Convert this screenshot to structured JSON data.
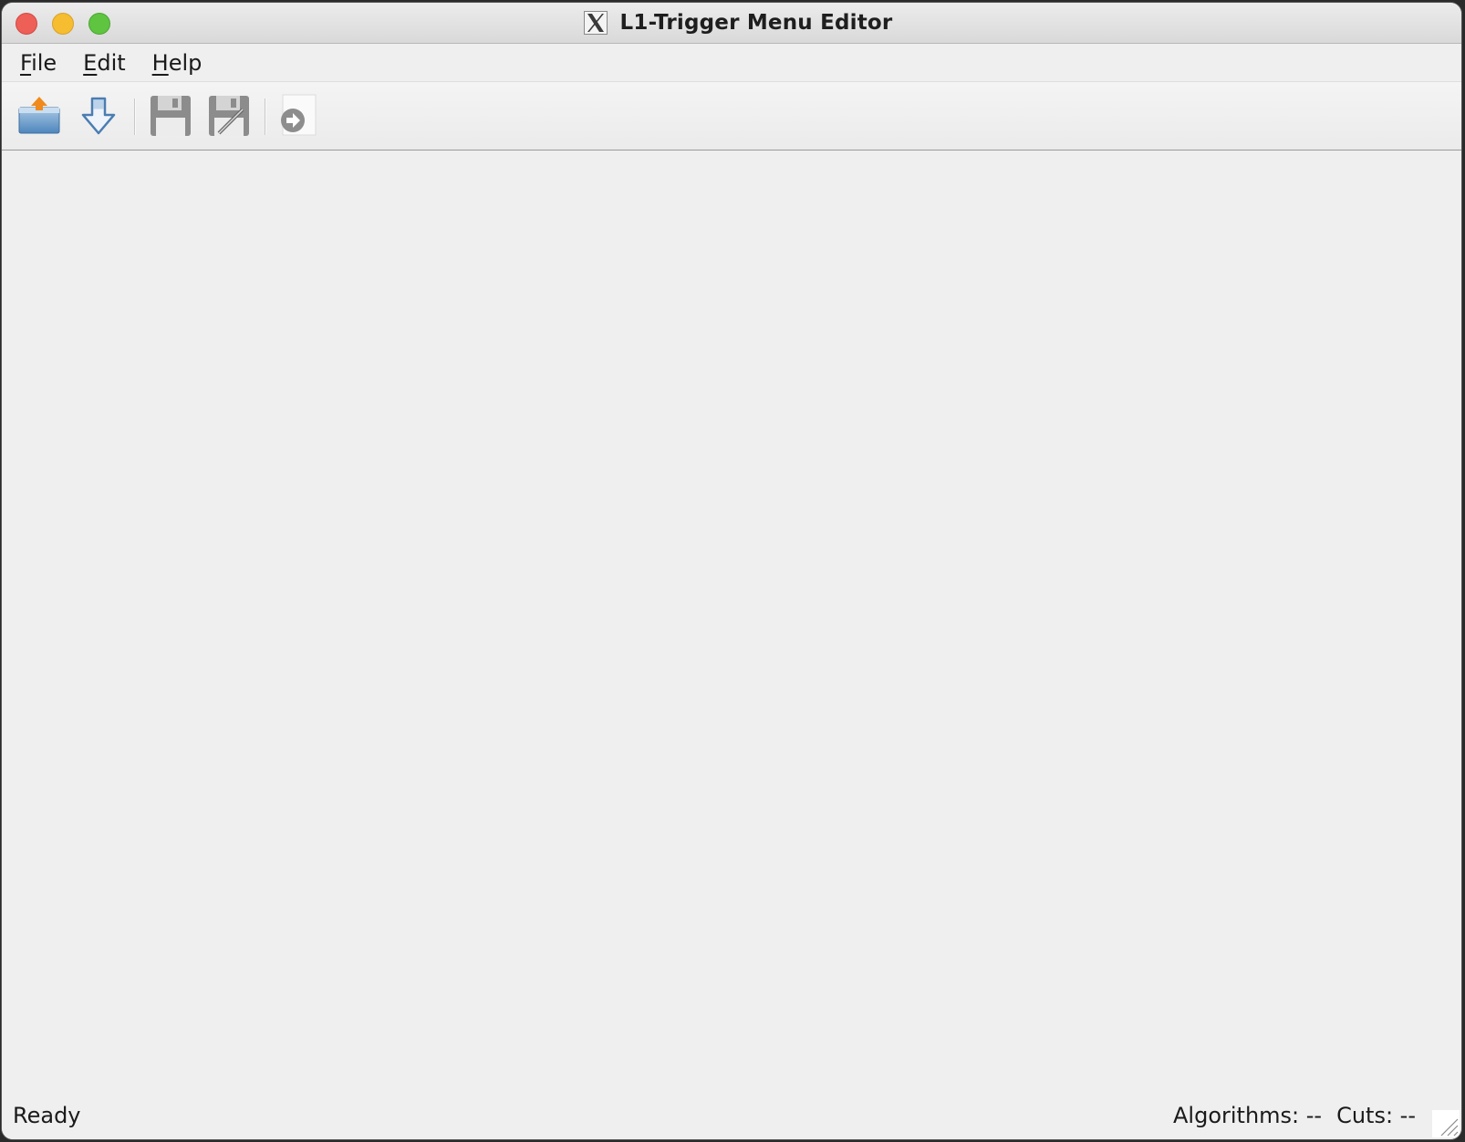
{
  "window": {
    "title": "L1-Trigger Menu Editor",
    "app_icon": "x11-icon"
  },
  "menubar": {
    "items": [
      {
        "mnemonic": "F",
        "rest": "ile"
      },
      {
        "mnemonic": "E",
        "rest": "dit"
      },
      {
        "mnemonic": "H",
        "rest": "elp"
      }
    ]
  },
  "toolbar": {
    "buttons": [
      {
        "icon": "open-folder-icon"
      },
      {
        "icon": "import-download-icon"
      },
      {
        "icon": "save-icon"
      },
      {
        "icon": "save-as-icon"
      },
      {
        "icon": "forward-arrow-icon"
      }
    ]
  },
  "statusbar": {
    "message": "Ready",
    "algorithms": "Algorithms: --",
    "cuts": "Cuts: --"
  },
  "colors": {
    "close": "#ee5f57",
    "minimize": "#f5bd2f",
    "maximize": "#5fc440",
    "window_bg": "#efefef"
  }
}
